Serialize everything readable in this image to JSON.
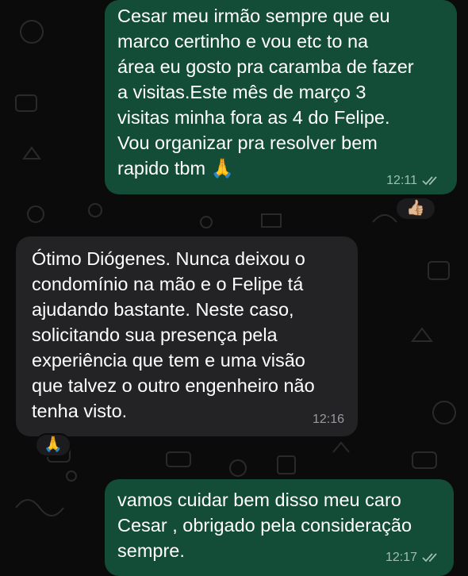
{
  "messages": [
    {
      "direction": "outgoing",
      "text": "Cesar meu irmão sempre que eu\nmarco certinho e vou  etc  to na\nárea eu gosto pra caramba de fazer\na visitas.Este mês de março 3\nvisitas minha fora as 4 do Felipe.\nVou organizar pra resolver bem\nrapido tbm 🙏",
      "time": "12:11",
      "status": "read",
      "reaction": "👍🏼"
    },
    {
      "direction": "incoming",
      "text": "Ótimo Diógenes. Nunca deixou o\ncondomínio na mão e o Felipe tá\najudando bastante.  Neste caso,\nsolicitando sua presença pela\nexperiência que tem e uma visão\nque talvez o outro engenheiro não\ntenha visto.",
      "time": "12:16",
      "reaction": "🙏"
    },
    {
      "direction": "outgoing",
      "text": "vamos cuidar bem disso meu caro\nCesar , obrigado pela consideração\nsempre.",
      "time": "12:17",
      "status": "read"
    }
  ],
  "colors": {
    "outgoing_bubble": "#134d37",
    "incoming_bubble": "#232326",
    "background": "#0b0b0b",
    "read_ticks": "#9fbfae"
  },
  "icons": [
    "double-check-icon"
  ]
}
